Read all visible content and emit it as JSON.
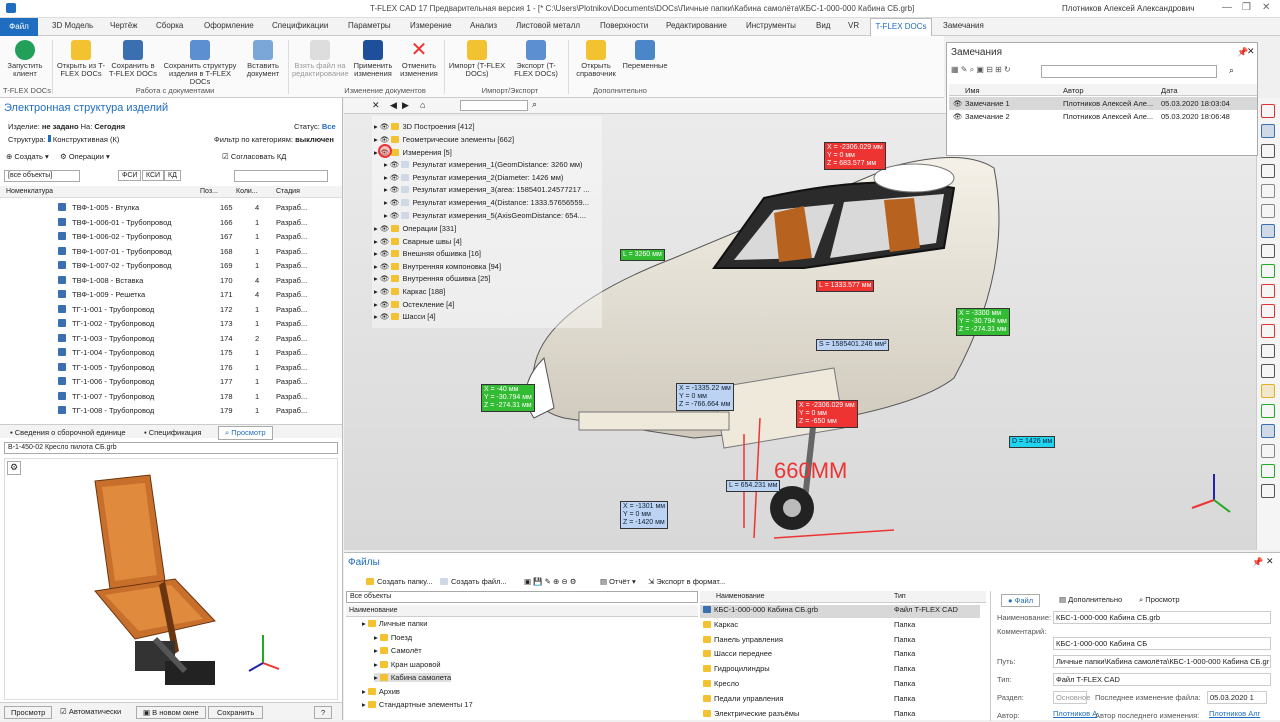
{
  "app": {
    "title": "T-FLEX CAD 17 Предварительная версия 1 - [* C:\\Users\\Plotnikov\\Documents\\DOCs\\Личные папки\\Кабина самолёта\\КБС-1-000-000 Кабина СБ.grb]",
    "user": "Плотников Алексей Александрович"
  },
  "menu": [
    "Файл",
    "3D Модель",
    "Чертёж",
    "Сборка",
    "Оформление",
    "Спецификации",
    "Параметры",
    "Измерение",
    "Анализ",
    "Листовой металл",
    "Поверхности",
    "Редактирование",
    "Инструменты",
    "Вид",
    "VR",
    "T-FLEX DOCs",
    "Замечания"
  ],
  "ribbon": {
    "buttons": [
      "Запустить клиент",
      "Открыть из T-FLEX DOCs",
      "Сохранить в T-FLEX DOCs",
      "Сохранить структуру изделия в T-FLEX DOCs",
      "Вставить документ",
      "Взять файл на редактирование",
      "Применить изменения",
      "Отменить изменения",
      "Импорт (T-FLEX DOCs)",
      "Экспорт (T-FLEX DOCs)",
      "Открыть справочник",
      "Переменные"
    ],
    "groups": [
      "T-FLEX DOCs",
      "Работа с документами",
      "Изменение документов",
      "Импорт/Экспорт",
      "Дополнительно"
    ]
  },
  "left": {
    "title": "Электронная структура изделий",
    "izdelie_label": "Изделие:",
    "izdelie_value": "не задано",
    "na_label": "На:",
    "na_value": "Сегодня",
    "status_label": "Статус:",
    "status_value": "Все",
    "structure_label": "Структура:",
    "structure_value": "Конструктивная (К)",
    "filter_label": "Фильтр по категориям:",
    "filter_value": "выключен",
    "tb": {
      "create": "Создать",
      "ops": "Операции",
      "agree": "Согласовать КД"
    },
    "objects": "[все объекты]",
    "fsi": "ФСИ",
    "ksi": "КСИ",
    "kd": "КД",
    "cols": [
      "Номенклатура",
      "Поз...",
      "Коли...",
      "Стадия"
    ],
    "rows": [
      {
        "n": "ТВФ-1-005 - Втулка",
        "p": "165",
        "q": "4",
        "s": "Разраб..."
      },
      {
        "n": "ТВФ-1-006-01 - Трубопровод",
        "p": "166",
        "q": "1",
        "s": "Разраб..."
      },
      {
        "n": "ТВФ-1-006-02 - Трубопровод",
        "p": "167",
        "q": "1",
        "s": "Разраб..."
      },
      {
        "n": "ТВФ-1-007-01 - Трубопровод",
        "p": "168",
        "q": "1",
        "s": "Разраб..."
      },
      {
        "n": "ТВФ-1-007-02 - Трубопровод",
        "p": "169",
        "q": "1",
        "s": "Разраб..."
      },
      {
        "n": "ТВФ-1-008 - Вставка",
        "p": "170",
        "q": "4",
        "s": "Разраб..."
      },
      {
        "n": "ТВФ-1-009 - Решетка",
        "p": "171",
        "q": "4",
        "s": "Разраб..."
      },
      {
        "n": "ТГ-1-001 - Трубопровод",
        "p": "172",
        "q": "1",
        "s": "Разраб..."
      },
      {
        "n": "ТГ-1-002 - Трубопровод",
        "p": "173",
        "q": "1",
        "s": "Разраб..."
      },
      {
        "n": "ТГ-1-003 - Трубопровод",
        "p": "174",
        "q": "2",
        "s": "Разраб..."
      },
      {
        "n": "ТГ-1-004 - Трубопровод",
        "p": "175",
        "q": "1",
        "s": "Разраб..."
      },
      {
        "n": "ТГ-1-005 - Трубопровод",
        "p": "176",
        "q": "1",
        "s": "Разраб..."
      },
      {
        "n": "ТГ-1-006 - Трубопровод",
        "p": "177",
        "q": "1",
        "s": "Разраб..."
      },
      {
        "n": "ТГ-1-007 - Трубопровод",
        "p": "178",
        "q": "1",
        "s": "Разраб..."
      },
      {
        "n": "ТГ-1-008 - Трубопровод",
        "p": "179",
        "q": "1",
        "s": "Разраб..."
      }
    ],
    "tabs": [
      "Сведения о сборочной единице",
      "Спецификация",
      "Просмотр"
    ],
    "preview_file": "В-1-450-02 Кресло пилота СБ.grb",
    "bottom": {
      "preview": "Просмотр",
      "auto": "Автоматически",
      "newwin": "В новом окне",
      "save": "Сохранить",
      "help": "?"
    }
  },
  "viewport": {
    "tree": [
      "3D Построения [412]",
      "Геометрические элементы [662]",
      "Измерения [5]",
      "Результат измерения_1(GeomDistance: 3260 мм)",
      "Результат измерения_2(Diameter: 1426 мм)",
      "Результат измерения_3(area: 1585401.24577217 ...",
      "Результат измерения_4(Distance: 1333.57656559...",
      "Результат измерения_5(AxisGeomDistance: 654....",
      "Операции [331]",
      "Сварные швы [4]",
      "Внешняя обшивка [16]",
      "Внутренняя компоновка [94]",
      "Внутренняя обшивка [25]",
      "Каркас [188]",
      "Остекление [4]",
      "Шасси [4]"
    ],
    "tags": {
      "t1": [
        "X = -2306.029 мм",
        "Y = 0 мм",
        "Z = 683.577 мм"
      ],
      "t2": "L = 3260 мм",
      "t3": "L = 1333.577 мм",
      "t4": [
        "X = -3300 мм",
        "Y = -30.794 мм",
        "Z = -274.31 мм"
      ],
      "t5": "S = 1585401.246 мм²",
      "t6": [
        "X = -40 мм",
        "Y = -30.794 мм",
        "Z = -274.31 мм"
      ],
      "t7": [
        "X = -1335.22 мм",
        "Y = 0 мм",
        "Z = -766.664 мм"
      ],
      "t8": [
        "X = -2306.029 мм",
        "Y = 0 мм",
        "Z = -650 мм"
      ],
      "t9": "D = 1426 мм",
      "t10": "L = 654.231 мм",
      "t11": [
        "X = -1301 мм",
        "Y = 0 мм",
        "Z = -1420 мм"
      ],
      "hand": "660ММ"
    }
  },
  "notes": {
    "title": "Замечания",
    "cols": [
      "Имя",
      "Автор",
      "Дата"
    ],
    "rows": [
      {
        "n": "Замечание 1",
        "a": "Плотников Алексей Але...",
        "d": "05.03.2020 18:03:04"
      },
      {
        "n": "Замечание 2",
        "a": "Плотников Алексей Але...",
        "d": "05.03.2020 18:06:48"
      }
    ]
  },
  "files": {
    "title": "Файлы",
    "create_folder": "Создать папку...",
    "create_file": "Создать файл...",
    "report": "Отчёт",
    "export": "Экспорт в формат...",
    "all": "Все объекты",
    "name_col": "Наименование",
    "type_col": "Тип",
    "tree": [
      "Личные папки",
      "Поезд",
      "Самолёт",
      "Кран шаровой",
      "Кабина самолета",
      "Архив",
      "Стандартные элементы 17"
    ],
    "list": [
      {
        "n": "КБС-1-000-000 Кабина СБ.grb",
        "t": "Файл T-FLEX CAD"
      },
      {
        "n": "Каркас",
        "t": "Папка"
      },
      {
        "n": "Панель управления",
        "t": "Папка"
      },
      {
        "n": "Шасси переднее",
        "t": "Папка"
      },
      {
        "n": "Гидроцилиндры",
        "t": "Папка"
      },
      {
        "n": "Кресло",
        "t": "Папка"
      },
      {
        "n": "Педали управления",
        "t": "Папка"
      },
      {
        "n": "Электрические разъёмы",
        "t": "Папка"
      }
    ],
    "props_tabs": [
      "Файл",
      "Дополнительно",
      "Просмотр"
    ],
    "props": {
      "name_l": "Наименование:",
      "name_v": "КБС-1-000-000 Кабина СБ.grb",
      "comment_l": "Комментарий:",
      "comment_v": "КБС-1-000-000 Кабина СБ",
      "path_l": "Путь:",
      "path_v": "Личные папки\\Кабина самолёта\\КБС-1-000-000 Кабина СБ.gr",
      "type_l": "Тип:",
      "type_v": "Файл T-FLEX CAD",
      "section_l": "Раздел:",
      "section_v": "Основное",
      "last_l": "Последнее изменение файла:",
      "last_v": "05.03.2020 1",
      "author_l": "Автор:",
      "author_v": "Плотников А",
      "lastauthor_l": "Автор последнего изменения:",
      "lastauthor_v": "Плотников Алг"
    }
  },
  "colors": {
    "accent": "#1e6dc0",
    "red_tag": "#e33333",
    "green_tag": "#33bb33",
    "blue_tag": "#bcd3f3",
    "cyan_tag": "#22d3ee"
  }
}
